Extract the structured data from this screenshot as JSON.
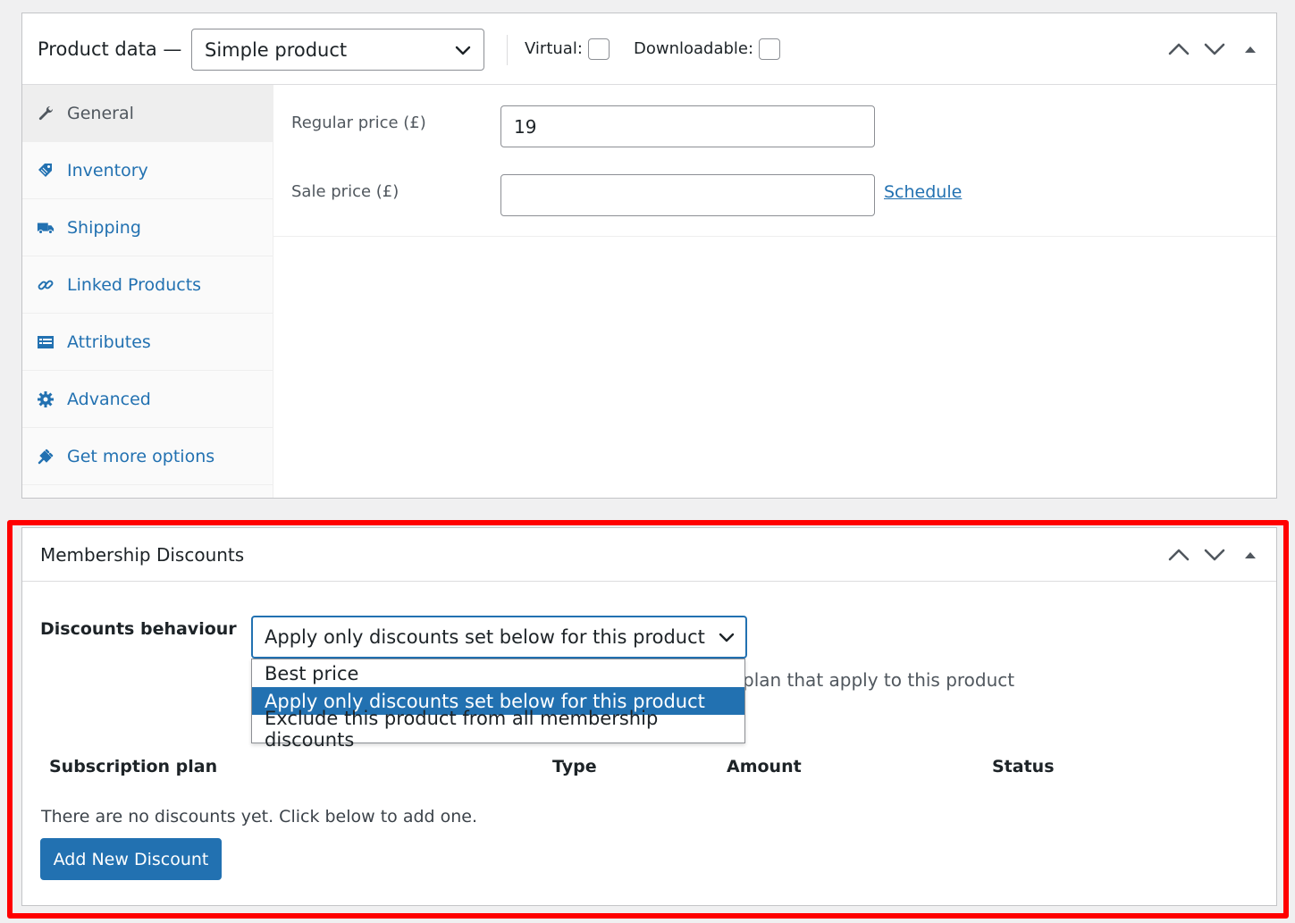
{
  "product_data": {
    "title": "Product data —",
    "product_type": "Simple product",
    "virtual_label": "Virtual:",
    "downloadable_label": "Downloadable:",
    "tabs": [
      {
        "label": "General",
        "icon": "wrench-icon"
      },
      {
        "label": "Inventory",
        "icon": "tag-icon"
      },
      {
        "label": "Shipping",
        "icon": "truck-icon"
      },
      {
        "label": "Linked Products",
        "icon": "link-icon"
      },
      {
        "label": "Attributes",
        "icon": "list-icon"
      },
      {
        "label": "Advanced",
        "icon": "gear-icon"
      },
      {
        "label": "Get more options",
        "icon": "plugin-icon"
      }
    ],
    "regular_price_label": "Regular price (£)",
    "regular_price_value": "19",
    "sale_price_label": "Sale price (£)",
    "sale_price_value": "",
    "schedule_link": "Schedule"
  },
  "membership": {
    "title": "Membership Discounts",
    "behaviour_label": "Discounts behaviour",
    "behaviour_selected": "Apply only discounts set below for this product",
    "behaviour_options": [
      "Best price",
      "Apply only discounts set below for this product",
      "Exclude this product from all membership discounts"
    ],
    "description_partial": "plan that apply to this product",
    "columns": [
      "Subscription plan",
      "Type",
      "Amount",
      "Status"
    ],
    "empty_message": "There are no discounts yet. Click below to add one.",
    "add_button": "Add New Discount"
  },
  "colors": {
    "accent": "#2271b1",
    "highlight": "#ff0000"
  }
}
